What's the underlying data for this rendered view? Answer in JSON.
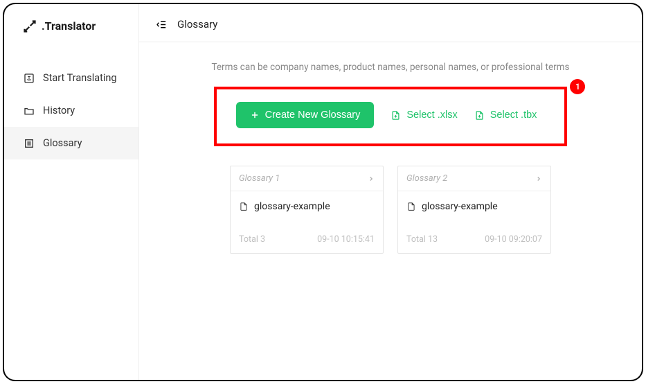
{
  "brand": ".Translator",
  "nav": {
    "start": "Start Translating",
    "history": "History",
    "glossary": "Glossary"
  },
  "topbar": {
    "title": "Glossary"
  },
  "helper": "Terms can be company names, product names, personal names, or professional terms",
  "actions": {
    "create": "Create New Glossary",
    "xlsx": "Select .xlsx",
    "tbx": "Select .tbx"
  },
  "callout": {
    "badge": "1"
  },
  "cards": [
    {
      "title": "Glossary 1",
      "file": "glossary-example",
      "total": "Total 3",
      "time": "09-10 10:15:41"
    },
    {
      "title": "Glossary 2",
      "file": "glossary-example",
      "total": "Total 13",
      "time": "09-10 09:20:07"
    }
  ]
}
